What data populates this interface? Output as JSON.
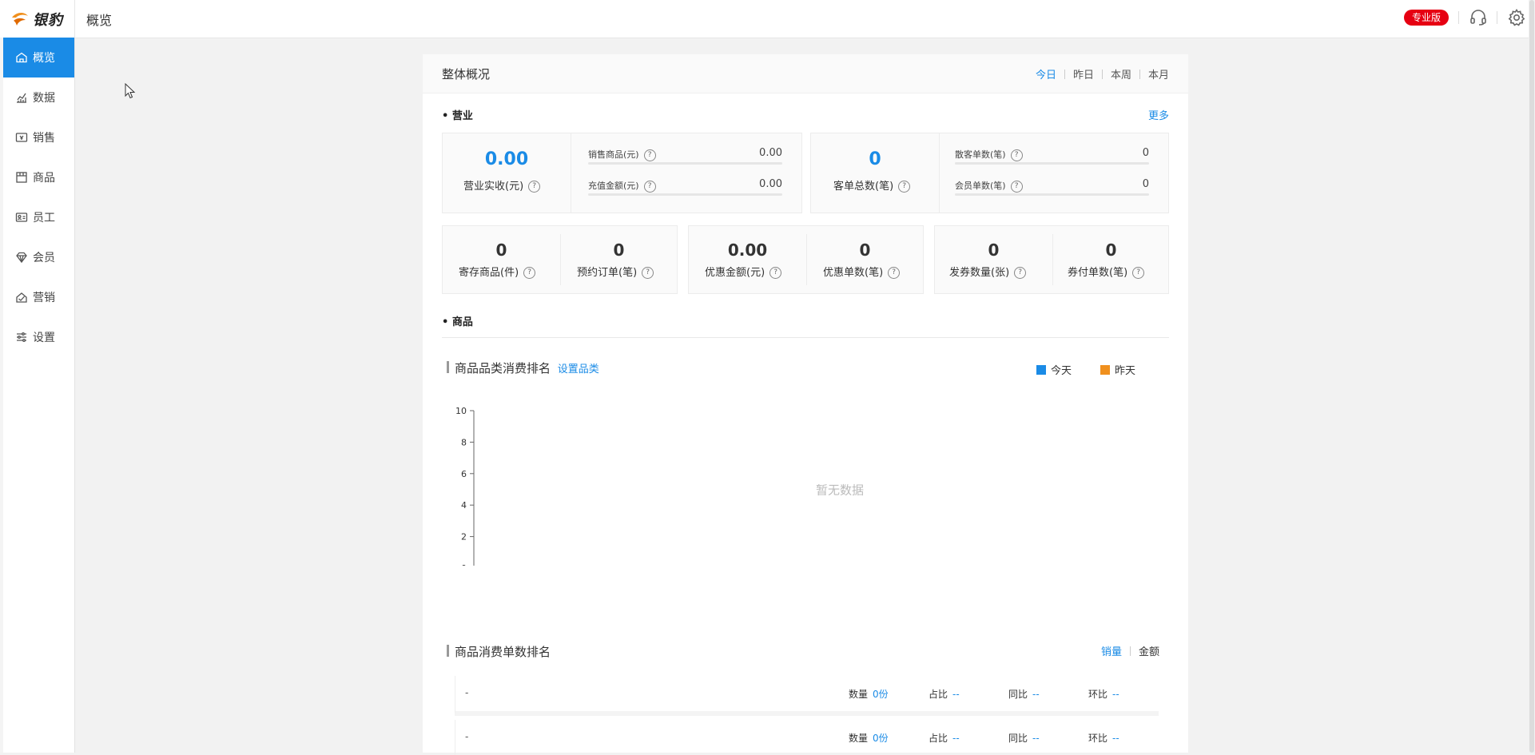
{
  "app": {
    "logo_text": "银豹",
    "page_title": "概览",
    "edition_badge": "专业版",
    "accent_color": "#1a8be6",
    "badge_color": "#e60012",
    "icons": [
      "headset-icon",
      "gear-icon"
    ]
  },
  "sidebar": {
    "items": [
      {
        "label": "概览",
        "icon": "home-icon",
        "active": true
      },
      {
        "label": "数据",
        "icon": "chart-icon",
        "active": false
      },
      {
        "label": "销售",
        "icon": "sales-icon",
        "active": false
      },
      {
        "label": "商品",
        "icon": "product-icon",
        "active": false
      },
      {
        "label": "员工",
        "icon": "staff-card-icon",
        "active": false
      },
      {
        "label": "会员",
        "icon": "diamond-icon",
        "active": false
      },
      {
        "label": "营销",
        "icon": "marketing-icon",
        "active": false
      },
      {
        "label": "设置",
        "icon": "sliders-icon",
        "active": false
      }
    ]
  },
  "overview": {
    "title": "整体概况",
    "range_tabs": [
      "今日",
      "昨日",
      "本周",
      "本月"
    ],
    "active_range": "今日"
  },
  "business": {
    "label": "• 营业",
    "more": "更多",
    "revenue": {
      "value": "0.00",
      "label": "营业实收(元)",
      "breakdown": [
        {
          "label": "销售商品(元)",
          "value": "0.00"
        },
        {
          "label": "充值金额(元)",
          "value": "0.00"
        }
      ]
    },
    "orders": {
      "value": "0",
      "label": "客单总数(笔)",
      "breakdown": [
        {
          "label": "散客单数(笔)",
          "value": "0"
        },
        {
          "label": "会员单数(笔)",
          "value": "0"
        }
      ]
    },
    "small_stats": [
      {
        "value": "0",
        "label": "寄存商品(件)"
      },
      {
        "value": "0",
        "label": "预约订单(笔)"
      },
      {
        "value": "0.00",
        "label": "优惠金额(元)"
      },
      {
        "value": "0",
        "label": "优惠单数(笔)"
      },
      {
        "value": "0",
        "label": "发券数量(张)"
      },
      {
        "value": "0",
        "label": "券付单数(笔)"
      }
    ]
  },
  "products": {
    "label": "• 商品",
    "category_chart": {
      "title": "商品品类消费排名",
      "link": "设置品类",
      "legend": [
        "今天",
        "昨天"
      ],
      "legend_colors": [
        "#1a8be6",
        "#f0901e"
      ],
      "empty_text": "暂无数据"
    },
    "ranking": {
      "title": "商品消费单数排名",
      "tabs": [
        "销量",
        "金额"
      ],
      "active_tab": "销量",
      "rows": [
        {
          "name": "-",
          "qty_label": "数量",
          "qty": "0份",
          "share_label": "占比",
          "share": "--",
          "yoy_label": "同比",
          "yoy": "--",
          "mom_label": "环比",
          "mom": "--"
        },
        {
          "name": "-",
          "qty_label": "数量",
          "qty": "0份",
          "share_label": "占比",
          "share": "--",
          "yoy_label": "同比",
          "yoy": "--",
          "mom_label": "环比",
          "mom": "--"
        }
      ]
    }
  },
  "chart_data": {
    "type": "bar",
    "categories": [],
    "series": [
      {
        "name": "今天",
        "values": []
      },
      {
        "name": "昨天",
        "values": []
      }
    ],
    "title": "商品品类消费排名",
    "xlabel": "",
    "ylabel": "",
    "ylim": [
      0,
      10
    ],
    "yticks": [
      0,
      2,
      4,
      6,
      8,
      10
    ],
    "grid": false,
    "legend_position": "top-right",
    "empty_text": "暂无数据"
  }
}
